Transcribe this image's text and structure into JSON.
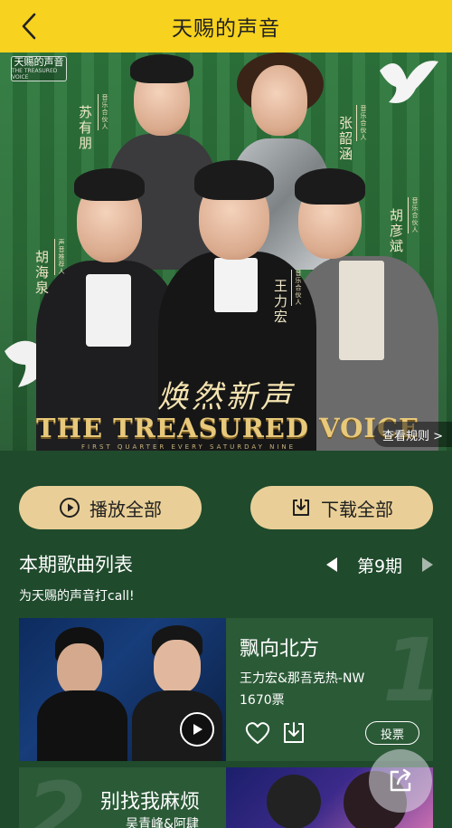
{
  "header": {
    "title": "天赐的声音"
  },
  "banner": {
    "show_logo_main": "天赐的声音",
    "show_logo_sub": "THE TREASURED VOICE",
    "slogan_cn": "焕然新声",
    "slogan_en": "THE TREASURED VOICE",
    "slogan_sub": "FIRST QUARTER EVERY SATURDAY NINE",
    "rules_link": "查看规则 >",
    "people": [
      {
        "name": "苏有朋",
        "role": "音乐合伙人"
      },
      {
        "name": "张韶涵",
        "role": "音乐合伙人"
      },
      {
        "name": "胡海泉",
        "role": "声音推荐人"
      },
      {
        "name": "胡彦斌",
        "role": "音乐合伙人"
      },
      {
        "name": "王力宏",
        "role": "音乐合伙人"
      }
    ]
  },
  "actions": {
    "play_all": "播放全部",
    "download_all": "下载全部"
  },
  "song_list": {
    "title": "本期歌曲列表",
    "issue_label": "第9期",
    "subtitle": "为天赐的声音打call!",
    "songs": [
      {
        "rank": "1",
        "title": "飘向北方",
        "artist": "王力宏&那吾克热-NW",
        "votes": "1670票",
        "vote_button": "投票"
      },
      {
        "rank": "2",
        "title": "别找我麻烦",
        "artist": "吴青峰&阿肆"
      }
    ]
  },
  "colors": {
    "topbar": "#f7d21e",
    "button_bg": "#e9cf97",
    "page_bg": "#1f4a2c"
  },
  "icons": [
    "back-arrow-icon",
    "play-circle-icon",
    "download-box-icon",
    "left-triangle-icon",
    "right-triangle-icon",
    "heart-icon",
    "download-icon",
    "share-icon"
  ]
}
